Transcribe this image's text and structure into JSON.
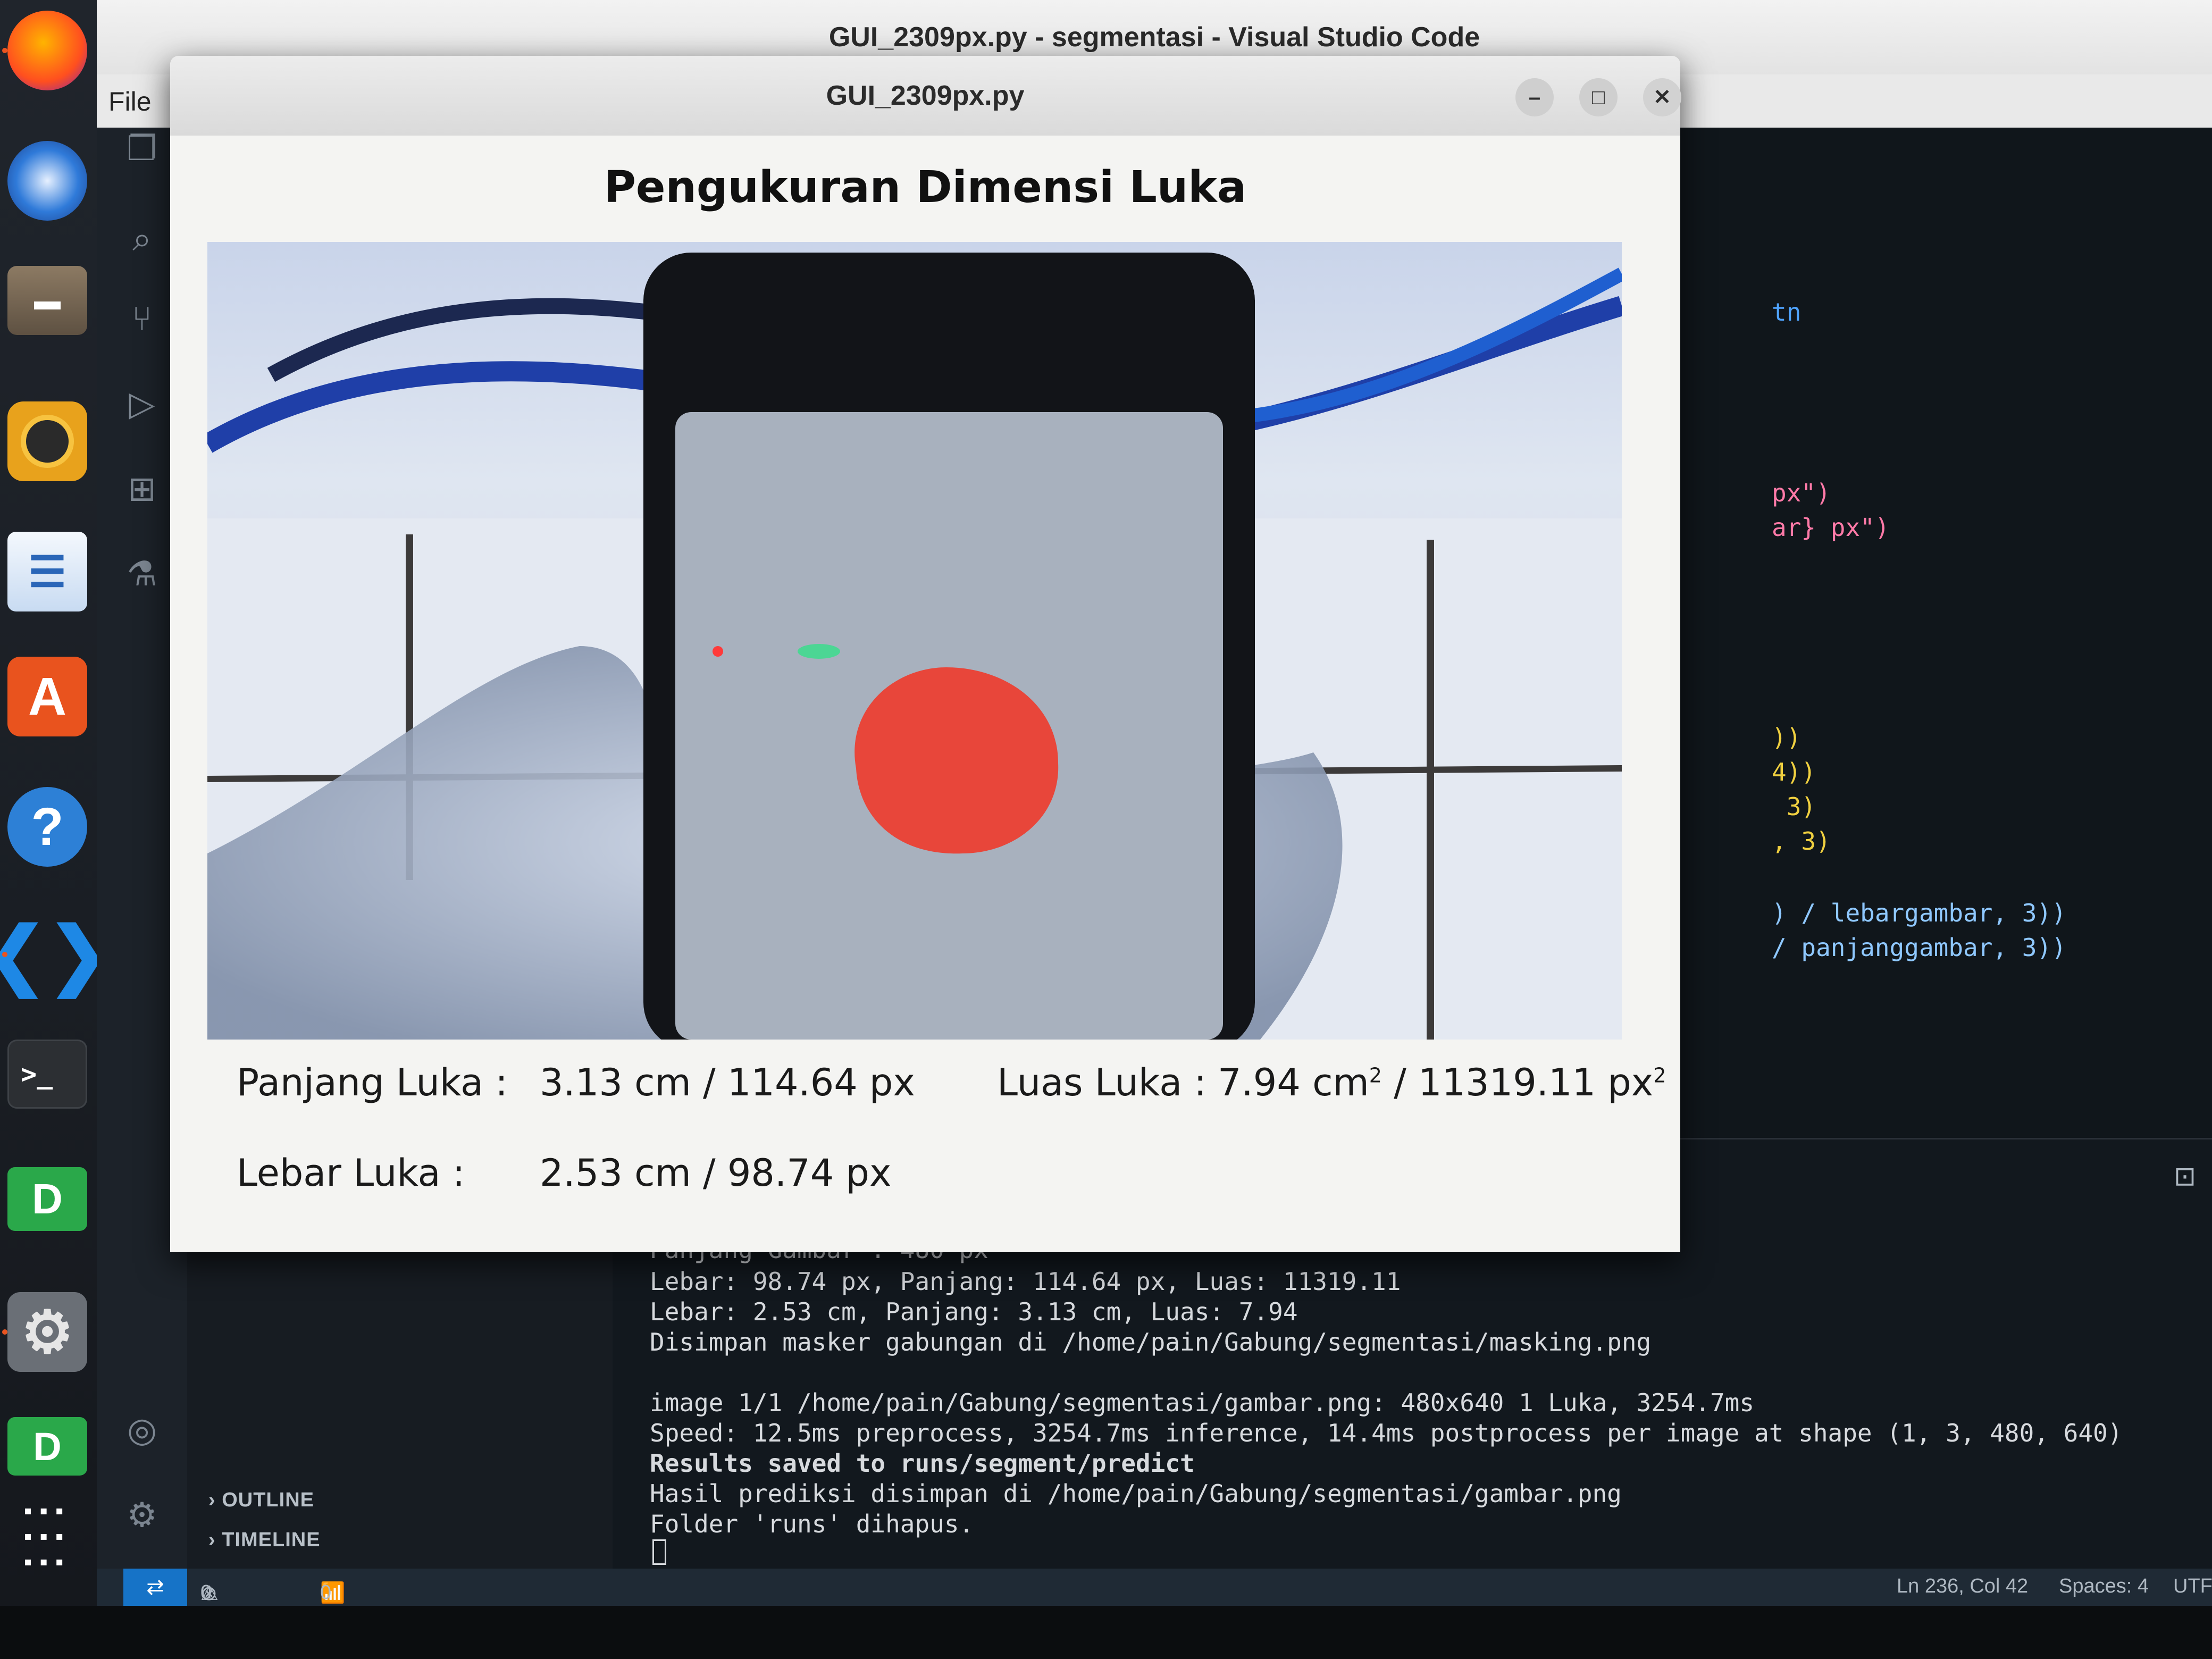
{
  "vscode": {
    "window_title": "GUI_2309px.py - segmentasi - Visual Studio Code",
    "menu": {
      "file": "File"
    },
    "sidebar": {
      "outline": "OUTLINE",
      "timeline": "TIMELINE"
    },
    "code_fragments": [
      {
        "text": "tn",
        "color": "#4fa3ff"
      },
      {
        "text": "px\")",
        "color": "#ff7aa8"
      },
      {
        "text": "ar} px\")",
        "color": "#ff7aa8"
      },
      {
        "text": "))",
        "color": "#f0d040"
      },
      {
        "text": "4))",
        "color": "#f0d040"
      },
      {
        "text": " 3)",
        "color": "#f0d040"
      },
      {
        "text": ", 3)",
        "color": "#f0d040"
      },
      {
        "text": ") / lebargambar, 3))",
        "color": "#8fc8ff"
      },
      {
        "text": "/ panjanggambar, 3))",
        "color": "#8fc8ff"
      }
    ],
    "terminal_lines": [
      "Panjang Gambar : 480 px",
      "Lebar: 98.74 px, Panjang: 114.64 px, Luas: 11319.11",
      "Lebar: 2.53 cm, Panjang: 3.13 cm, Luas: 7.94",
      "Disimpan masker gabungan di /home/pain/Gabung/segmentasi/masking.png",
      "",
      "image 1/1 /home/pain/Gabung/segmentasi/gambar.png: 480x640 1 Luka, 3254.7ms",
      "Speed: 12.5ms preprocess, 3254.7ms inference, 14.4ms postprocess per image at shape (1, 3, 480, 640)",
      "Results saved to runs/segment/predict",
      "Hasil prediksi disimpan di /home/pain/Gabung/segmentasi/gambar.png",
      "Folder 'runs' dihapus."
    ],
    "status": {
      "errors": "0",
      "warnings": "0",
      "ports": "0",
      "cursor": "Ln 236, Col 42",
      "spaces": "Spaces: 4",
      "encoding": "UTF"
    }
  },
  "gui": {
    "window_title": "GUI_2309px.py",
    "heading": "Pengukuran Dimensi Luka",
    "panjang_label": "Panjang Luka :",
    "panjang_value": "3.13 cm / 114.64 px",
    "lebar_label": "Lebar Luka :",
    "lebar_value": "2.53 cm / 98.74 px",
    "luas_label": "Luas Luka :",
    "luas_cm": "7.94 cm",
    "luas_px": "11319.11 px",
    "luas_sep": " / ",
    "superscript": "2"
  },
  "dock": {
    "items": [
      "firefox-icon",
      "thunderbird-icon",
      "files-icon",
      "rhythmbox-icon",
      "writer-icon",
      "app-center-icon",
      "help-icon",
      "vscode-icon",
      "terminal-icon",
      "d-app-icon",
      "settings-icon",
      "d-app-2-icon",
      "show-apps-icon"
    ]
  },
  "colors": {
    "wound": "#e8463a",
    "vscode_blue": "#1673c7",
    "ubuntu_orange": "#e95420"
  }
}
